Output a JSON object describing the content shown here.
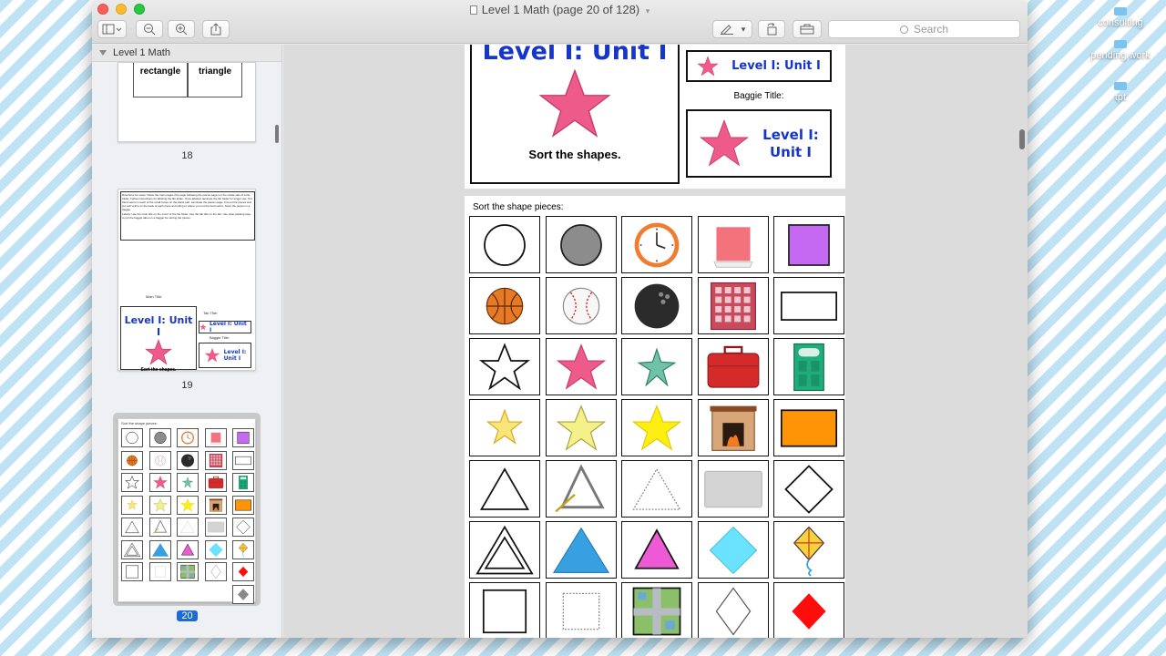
{
  "desktop": {
    "icons": [
      "consulting",
      "pending work",
      "tpt"
    ]
  },
  "window": {
    "title": "Level 1 Math (page 20 of 128)",
    "search_placeholder": "Search"
  },
  "sidebar": {
    "document_name": "Level 1 Math",
    "page18": {
      "labels": [
        "rectangle",
        "triangle"
      ],
      "number": "18"
    },
    "page19": {
      "number": "19",
      "directions": "Directions for setup: Paste the main pages (the page following the pieces page) on the inside side of a file folder. Follow instructions for labeling the file folder. Once labeled, laminate the file folder for longer use. Put hand velcro in each of the small boxes on the blank part. Laminate the pieces page. Cut out the pieces and put soft velcro on the back of each piece according to where you put the hard velcro. Store the pieces in a baggie.",
      "labels_text": "Labels: Use the main title on the cover of the file folder. Use the tab title on the tab. Use clear packing tape to put the baggie label on a baggie for storing the pieces.",
      "main_title_label": "Main Title:",
      "tab_title_label": "Tab Title:",
      "baggie_title_label": "Baggie Title:",
      "title": "Level I: Unit I",
      "sort_text": "Sort the shapes.",
      "tab_title": "Level I: Unit I",
      "baggie_title_line1": "Level I:",
      "baggie_title_line2": "Unit I"
    },
    "page20": {
      "number": "20",
      "header": "Sort the shape pieces:"
    }
  },
  "page_top": {
    "main_title": "Level I: Unit I",
    "sort_text": "Sort the shapes.",
    "tab_title": "Level I: Unit I",
    "baggie_label": "Baggie Title:",
    "baggie_title_line1": "Level I:",
    "baggie_title_line2": "Unit I"
  },
  "page_pieces": {
    "header": "Sort the shape pieces:",
    "pieces": [
      [
        "circle-outline",
        "gray-circle",
        "clock",
        "pink-square-card",
        "purple-square"
      ],
      [
        "basketball",
        "baseball",
        "bowling-ball",
        "checkered-square-blanket",
        "rectangle-outline"
      ],
      [
        "star-outline",
        "pink-star",
        "green-starfish",
        "red-suitcase",
        "green-door"
      ],
      [
        "yellow-star-small",
        "yellow-star",
        "bright-yellow-star",
        "fireplace",
        "orange-rectangle"
      ],
      [
        "triangle-outline",
        "musical-triangle",
        "dotted-triangle",
        "gray-rectangle",
        "diamond-outline"
      ],
      [
        "triangle-double-outline",
        "blue-triangle",
        "pink-triangle",
        "cyan-diamond",
        "kite"
      ],
      [
        "square-outline",
        "dotted-square",
        "map-square",
        "dotted-diamond",
        "red-diamond"
      ]
    ]
  }
}
